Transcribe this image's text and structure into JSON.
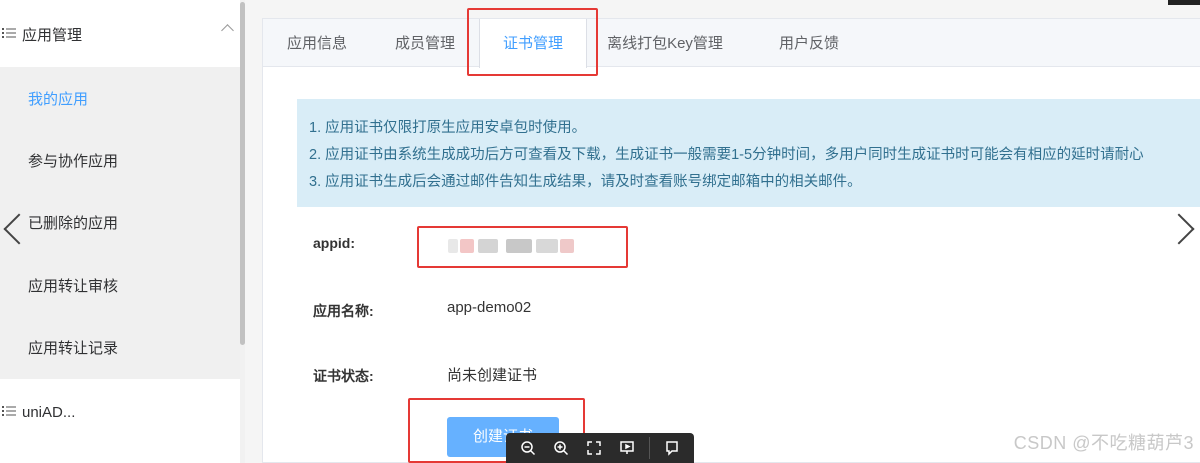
{
  "sidebar": {
    "group1": {
      "label": "应用管理",
      "icon": "list-icon",
      "chevron": "chevron-up-icon"
    },
    "items": [
      {
        "label": "我的应用",
        "active": true
      },
      {
        "label": "参与协作应用",
        "active": false
      },
      {
        "label": "已删除的应用",
        "active": false
      },
      {
        "label": "应用转让审核",
        "active": false
      },
      {
        "label": "应用转让记录",
        "active": false
      }
    ],
    "group2": {
      "label": "uniAD...",
      "icon": "list-icon"
    }
  },
  "tabs": [
    {
      "label": "应用信息",
      "active": false
    },
    {
      "label": "成员管理",
      "active": false
    },
    {
      "label": "证书管理",
      "active": true
    },
    {
      "label": "离线打包Key管理",
      "active": false
    },
    {
      "label": "用户反馈",
      "active": false
    }
  ],
  "notice": {
    "lines": [
      "1. 应用证书仅限打原生应用安卓包时使用。",
      "2. 应用证书由系统生成成功后方可查看及下载，生成证书一般需要1-5分钟时间，多用户同时生成证书时可能会有相应的延时请耐心",
      "3. 应用证书生成后会通过邮件告知生成结果，请及时查看账号绑定邮箱中的相关邮件。"
    ]
  },
  "fields": {
    "appid_label": "appid:",
    "name_label": "应用名称:",
    "name_value": "app-demo02",
    "status_label": "证书状态:",
    "status_value": "尚未创建证书"
  },
  "button": {
    "create_label": "创建证书"
  },
  "viewer_toolbar": {
    "icons": [
      "zoom-out-icon",
      "zoom-in-icon",
      "fullscreen-icon",
      "presentation-icon",
      "comment-icon"
    ]
  },
  "watermark": "CSDN @不吃糖葫芦3",
  "colors": {
    "accent": "#409eff",
    "button": "#66b1ff",
    "notice_bg": "#d9edf7",
    "notice_text": "#31708f",
    "annotation": "#e53935"
  }
}
